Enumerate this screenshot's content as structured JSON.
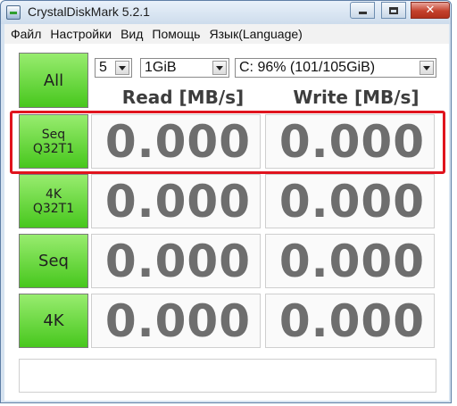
{
  "window": {
    "title": "CrystalDiskMark 5.2.1"
  },
  "menu": [
    "Файл",
    "Настройки",
    "Вид",
    "Помощь",
    "Язык(Language)"
  ],
  "controls": {
    "all_button": "All",
    "count_select": "5",
    "size_select": "1GiB",
    "drive_select": "C: 96% (101/105GiB)"
  },
  "headers": {
    "read": "Read [MB/s]",
    "write": "Write [MB/s]"
  },
  "tests": [
    {
      "line1": "Seq",
      "line2": "Q32T1",
      "read": "0.000",
      "write": "0.000"
    },
    {
      "line1": "4K",
      "line2": "Q32T1",
      "read": "0.000",
      "write": "0.000"
    },
    {
      "line1": "Seq",
      "line2": "",
      "read": "0.000",
      "write": "0.000"
    },
    {
      "line1": "4K",
      "line2": "",
      "read": "0.000",
      "write": "0.000"
    }
  ],
  "colors": {
    "button_green": "#47c71d",
    "highlight": "#e0141e"
  }
}
